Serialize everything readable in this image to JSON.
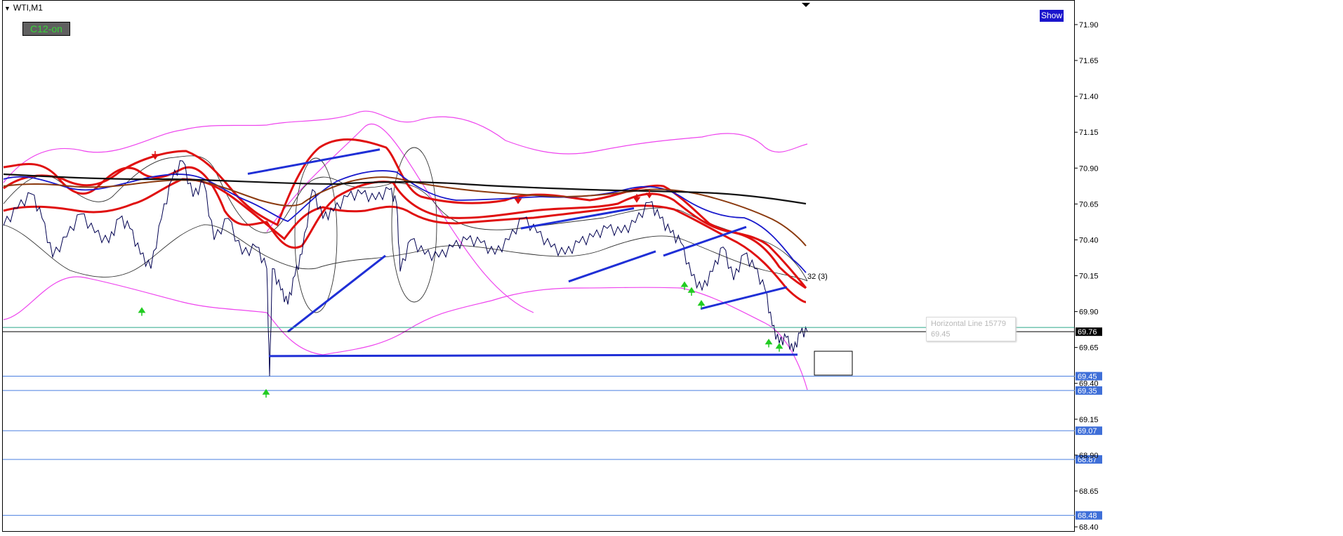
{
  "header": {
    "symbol": "WTI,M1"
  },
  "indicator_badge": {
    "label": "C12-on"
  },
  "show_button": {
    "label": "Show"
  },
  "tooltip": {
    "line1": "Horizontal Line 15779",
    "line2": "69.45"
  },
  "bar_label": "32 (3)",
  "colors": {
    "background": "#ffffff",
    "price": "#000050",
    "red_band": "#e01010",
    "blue_ma": "#1a1acc",
    "brown_ma": "#8b3a0f",
    "black_ma": "#111111",
    "magenta_band": "#ee44ee",
    "thin_band": "#333333",
    "trendline": "#1f2fd6",
    "hline": "#4a7fe0",
    "tag_bg": "#3f6fd8",
    "current_tag_bg": "#000000",
    "up_arrow": "#22cc22",
    "down_arrow": "#dd1111"
  },
  "chart_data": {
    "type": "line",
    "symbol": "WTI",
    "timeframe": "M1",
    "ylim": [
      68.4,
      71.95
    ],
    "y_ticks": [
      71.9,
      71.65,
      71.4,
      71.15,
      70.9,
      70.65,
      70.4,
      70.15,
      69.9,
      69.65,
      69.4,
      69.15,
      68.9,
      68.65,
      68.4
    ],
    "current_price": 69.76,
    "price_path": [
      [
        0,
        70.5
      ],
      [
        20,
        70.62
      ],
      [
        40,
        70.72
      ],
      [
        55,
        70.55
      ],
      [
        70,
        70.28
      ],
      [
        90,
        70.42
      ],
      [
        110,
        70.58
      ],
      [
        130,
        70.45
      ],
      [
        150,
        70.38
      ],
      [
        165,
        70.55
      ],
      [
        180,
        70.48
      ],
      [
        195,
        70.3
      ],
      [
        210,
        70.2
      ],
      [
        225,
        70.55
      ],
      [
        240,
        70.82
      ],
      [
        255,
        70.95
      ],
      [
        270,
        70.7
      ],
      [
        285,
        70.8
      ],
      [
        300,
        70.4
      ],
      [
        320,
        70.55
      ],
      [
        340,
        70.3
      ],
      [
        360,
        70.35
      ],
      [
        375,
        70.2
      ],
      [
        379,
        69.45
      ],
      [
        383,
        70.2
      ],
      [
        395,
        70.05
      ],
      [
        405,
        69.95
      ],
      [
        415,
        70.15
      ],
      [
        425,
        70.3
      ],
      [
        440,
        70.75
      ],
      [
        455,
        70.55
      ],
      [
        470,
        70.6
      ],
      [
        490,
        70.7
      ],
      [
        510,
        70.72
      ],
      [
        530,
        70.68
      ],
      [
        550,
        70.75
      ],
      [
        560,
        70.65
      ],
      [
        565,
        70.18
      ],
      [
        580,
        70.4
      ],
      [
        600,
        70.3
      ],
      [
        620,
        70.28
      ],
      [
        640,
        70.35
      ],
      [
        660,
        70.4
      ],
      [
        680,
        70.38
      ],
      [
        700,
        70.3
      ],
      [
        720,
        70.4
      ],
      [
        740,
        70.55
      ],
      [
        760,
        70.45
      ],
      [
        780,
        70.35
      ],
      [
        800,
        70.3
      ],
      [
        820,
        70.38
      ],
      [
        840,
        70.42
      ],
      [
        860,
        70.48
      ],
      [
        880,
        70.45
      ],
      [
        900,
        70.52
      ],
      [
        920,
        70.66
      ],
      [
        935,
        70.55
      ],
      [
        950,
        70.45
      ],
      [
        965,
        70.38
      ],
      [
        980,
        70.15
      ],
      [
        995,
        70.05
      ],
      [
        1010,
        70.18
      ],
      [
        1025,
        70.35
      ],
      [
        1040,
        70.12
      ],
      [
        1055,
        70.3
      ],
      [
        1070,
        70.2
      ],
      [
        1085,
        70.05
      ],
      [
        1095,
        69.8
      ],
      [
        1105,
        69.68
      ],
      [
        1115,
        69.72
      ],
      [
        1125,
        69.62
      ],
      [
        1135,
        69.75
      ],
      [
        1145,
        69.76
      ]
    ],
    "down_arrows": [
      [
        221,
        70.97
      ],
      [
        738,
        70.66
      ],
      [
        907,
        70.67
      ],
      [
        925,
        70.7
      ]
    ],
    "up_arrows": [
      [
        202,
        69.9
      ],
      [
        379,
        69.33
      ],
      [
        975,
        70.08
      ],
      [
        985,
        70.04
      ],
      [
        999,
        69.95
      ],
      [
        1095,
        69.68
      ],
      [
        1110,
        69.65
      ]
    ],
    "trendlines": [
      [
        [
          353,
          70.86
        ],
        [
          541,
          71.03
        ]
      ],
      [
        [
          410,
          69.76
        ],
        [
          549,
          70.29
        ]
      ],
      [
        [
          742,
          70.48
        ],
        [
          903,
          70.62
        ]
      ],
      [
        [
          810,
          70.11
        ],
        [
          934,
          70.32
        ]
      ],
      [
        [
          945,
          70.29
        ],
        [
          1063,
          70.49
        ]
      ],
      [
        [
          998,
          69.92
        ],
        [
          1121,
          70.07
        ]
      ],
      [
        [
          383,
          69.59
        ],
        [
          1136,
          69.6
        ]
      ]
    ],
    "horizontal_lines": [
      {
        "label": "69.45",
        "price": 69.45
      },
      {
        "label": "69.35",
        "price": 69.35
      },
      {
        "label": "69.07",
        "price": 69.07
      },
      {
        "label": "68.87",
        "price": 68.87
      },
      {
        "label": "68.48",
        "price": 68.48
      }
    ]
  }
}
